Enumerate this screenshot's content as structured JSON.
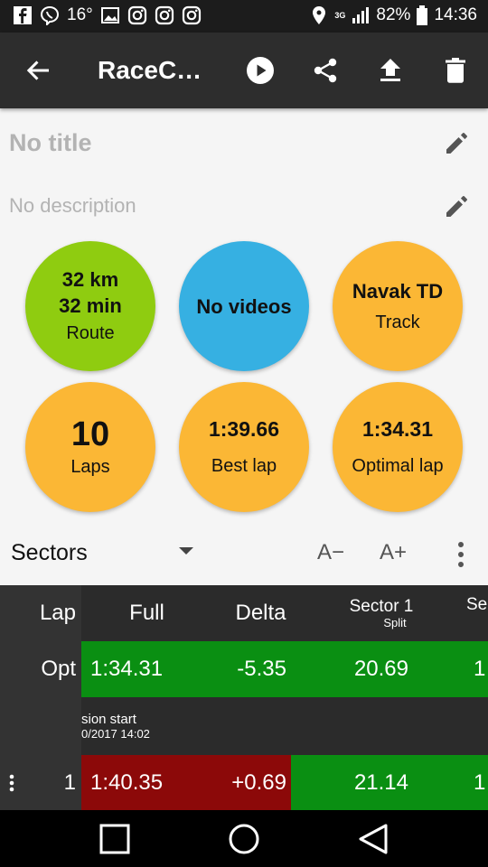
{
  "status_bar": {
    "temperature": "16°",
    "battery": "82%",
    "time": "14:36",
    "network": "3G",
    "left_icons": [
      "facebook-icon",
      "viber-icon",
      "gallery-icon",
      "instagram-icon",
      "instagram-icon",
      "instagram-icon"
    ],
    "right_icons": [
      "location-icon",
      "signal-icon",
      "battery-icon"
    ]
  },
  "toolbar": {
    "title": "RaceCh…",
    "icons": [
      "back-arrow-icon",
      "play-icon",
      "share-icon",
      "upload-icon",
      "delete-icon"
    ]
  },
  "session": {
    "title": "No title",
    "description": "No description"
  },
  "summary": {
    "route": {
      "line1": "32 km",
      "line2": "32 min",
      "label": "Route",
      "color": "#8fcc10"
    },
    "videos": {
      "line1": "No videos",
      "color": "#36b0e2"
    },
    "track": {
      "line1": "Navak TD",
      "label": "Track",
      "color": "#fbb735"
    },
    "laps": {
      "line1": "10",
      "label": "Laps",
      "color": "#fbb735"
    },
    "best_lap": {
      "line1": "1:39.66",
      "label": "Best lap",
      "color": "#fbb735"
    },
    "optimal_lap": {
      "line1": "1:34.31",
      "label": "Optimal lap",
      "color": "#fbb735"
    }
  },
  "sectors": {
    "selected": "Sectors",
    "font_decrease": "A−",
    "font_increase": "A+"
  },
  "table": {
    "headers": {
      "lap": "Lap",
      "full": "Full",
      "delta": "Delta",
      "sector1": "Sector 1",
      "sector1_sub": "Split",
      "sector2_partial": "Se"
    },
    "opt_row": {
      "lap": "Opt",
      "full": "1:34.31",
      "delta": "-5.35",
      "sector1": "20.69",
      "sector2_partial": "1"
    },
    "session_row": {
      "line1": "sion start",
      "line2": "0/2017 14:02"
    },
    "lap_row": {
      "lap": "1",
      "full": "1:40.35",
      "delta": "+0.69",
      "sector1": "21.14",
      "sector2_partial": "1"
    },
    "colors": {
      "green": "#0a8f12",
      "red": "#8c0909"
    }
  },
  "navbar": {
    "icons": [
      "recents-icon",
      "home-icon",
      "back-icon"
    ]
  }
}
